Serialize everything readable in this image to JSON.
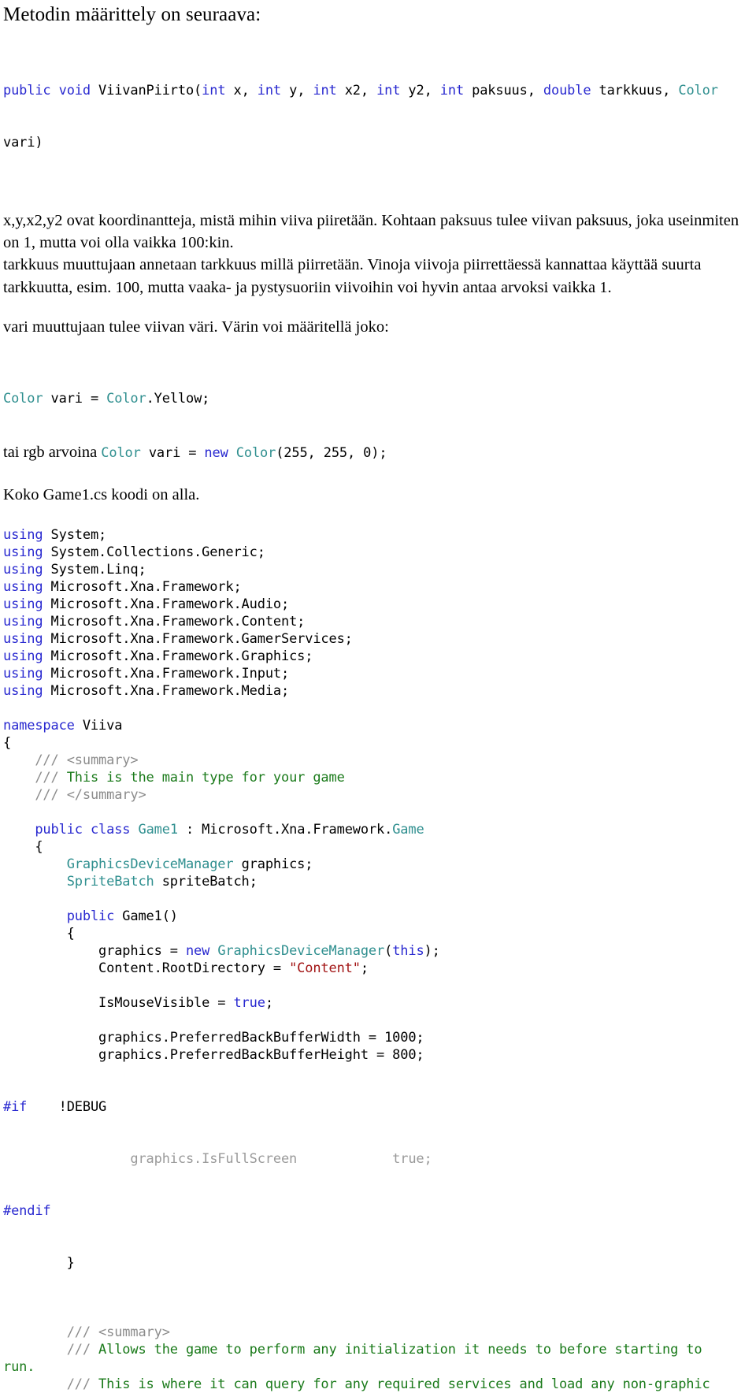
{
  "document": {
    "title": "Metodin määrittely on seuraava:",
    "signature": {
      "line1": [
        {
          "t": "public",
          "c": "kw"
        },
        {
          "t": " ",
          "c": "num"
        },
        {
          "t": "void",
          "c": "kw"
        },
        {
          "t": " ViivanPiirto(",
          "c": "num"
        },
        {
          "t": "int",
          "c": "kw"
        },
        {
          "t": " x, ",
          "c": "num"
        },
        {
          "t": "int",
          "c": "kw"
        },
        {
          "t": " y, ",
          "c": "num"
        },
        {
          "t": "int",
          "c": "kw"
        },
        {
          "t": " x2, ",
          "c": "num"
        },
        {
          "t": "int",
          "c": "kw"
        },
        {
          "t": " y2, ",
          "c": "num"
        },
        {
          "t": "int",
          "c": "kw"
        },
        {
          "t": " paksuus, ",
          "c": "num"
        },
        {
          "t": "double",
          "c": "kw"
        },
        {
          "t": " tarkkuus, ",
          "c": "num"
        },
        {
          "t": "Color",
          "c": "typ"
        }
      ],
      "line2": "vari)"
    },
    "paragraph1": "x,y,x2,y2 ovat koordinantteja, mistä mihin viiva piiretään. Kohtaan paksuus tulee viivan paksuus, joka useinmiten on 1, mutta voi olla vaikka 100:kin.",
    "paragraph2": "tarkkuus muuttujaan annetaan tarkkuus millä piirretään. Vinoja viivoja piirrettäessä kannattaa käyttää suurta tarkkuutta, esim. 100, mutta vaaka- ja pystysuoriin viivoihin voi hyvin antaa arvoksi vaikka 1.",
    "paragraph3": "vari muuttujaan tulee viivan väri. Värin voi määritellä joko:",
    "color_example_1": [
      {
        "t": "Color",
        "c": "typ"
      },
      {
        "t": " vari = ",
        "c": "num"
      },
      {
        "t": "Color",
        "c": "typ"
      },
      {
        "t": ".Yellow;",
        "c": "num"
      }
    ],
    "color_example_2_prefix": "tai rgb arvoina ",
    "color_example_2": [
      {
        "t": "Color",
        "c": "typ"
      },
      {
        "t": " vari = ",
        "c": "num"
      },
      {
        "t": "new",
        "c": "kw"
      },
      {
        "t": " ",
        "c": "num"
      },
      {
        "t": "Color",
        "c": "typ"
      },
      {
        "t": "(255, 255, 0);",
        "c": "num"
      }
    ],
    "paragraph4": "Koko Game1.cs koodi on alla."
  },
  "code_listing": {
    "usings": [
      [
        {
          "t": "using",
          "c": "kw"
        },
        {
          "t": " System;",
          "c": "num"
        }
      ],
      [
        {
          "t": "using",
          "c": "kw"
        },
        {
          "t": " System.Collections.Generic;",
          "c": "num"
        }
      ],
      [
        {
          "t": "using",
          "c": "kw"
        },
        {
          "t": " System.Linq;",
          "c": "num"
        }
      ],
      [
        {
          "t": "using",
          "c": "kw"
        },
        {
          "t": " Microsoft.Xna.Framework;",
          "c": "num"
        }
      ],
      [
        {
          "t": "using",
          "c": "kw"
        },
        {
          "t": " Microsoft.Xna.Framework.Audio;",
          "c": "num"
        }
      ],
      [
        {
          "t": "using",
          "c": "kw"
        },
        {
          "t": " Microsoft.Xna.Framework.Content;",
          "c": "num"
        }
      ],
      [
        {
          "t": "using",
          "c": "kw"
        },
        {
          "t": " Microsoft.Xna.Framework.GamerServices;",
          "c": "num"
        }
      ],
      [
        {
          "t": "using",
          "c": "kw"
        },
        {
          "t": " Microsoft.Xna.Framework.Graphics;",
          "c": "num"
        }
      ],
      [
        {
          "t": "using",
          "c": "kw"
        },
        {
          "t": " Microsoft.Xna.Framework.Input;",
          "c": "num"
        }
      ],
      [
        {
          "t": "using",
          "c": "kw"
        },
        {
          "t": " Microsoft.Xna.Framework.Media;",
          "c": "num"
        }
      ]
    ],
    "body": [
      [
        {
          "t": "namespace",
          "c": "kw"
        },
        {
          "t": " Viiva",
          "c": "num"
        }
      ],
      [
        {
          "t": "{",
          "c": "num"
        }
      ],
      [
        {
          "t": "    /// ",
          "c": "cms"
        },
        {
          "t": "<summary>",
          "c": "cms"
        }
      ],
      [
        {
          "t": "    /// ",
          "c": "cms"
        },
        {
          "t": "This is the main type for your game",
          "c": "cmt"
        }
      ],
      [
        {
          "t": "    /// ",
          "c": "cms"
        },
        {
          "t": "</summary>",
          "c": "cms"
        }
      ],
      [
        {
          "t": "",
          "c": "num"
        }
      ],
      [
        {
          "t": "    ",
          "c": "num"
        },
        {
          "t": "public",
          "c": "kw"
        },
        {
          "t": " ",
          "c": "num"
        },
        {
          "t": "class",
          "c": "kw"
        },
        {
          "t": " ",
          "c": "num"
        },
        {
          "t": "Game1",
          "c": "typ"
        },
        {
          "t": " : Microsoft.Xna.Framework.",
          "c": "num"
        },
        {
          "t": "Game",
          "c": "typ"
        }
      ],
      [
        {
          "t": "    {",
          "c": "num"
        }
      ],
      [
        {
          "t": "        ",
          "c": "num"
        },
        {
          "t": "GraphicsDeviceManager",
          "c": "typ"
        },
        {
          "t": " graphics;",
          "c": "num"
        }
      ],
      [
        {
          "t": "        ",
          "c": "num"
        },
        {
          "t": "SpriteBatch",
          "c": "typ"
        },
        {
          "t": " spriteBatch;",
          "c": "num"
        }
      ],
      [
        {
          "t": "",
          "c": "num"
        }
      ],
      [
        {
          "t": "        ",
          "c": "num"
        },
        {
          "t": "public",
          "c": "kw"
        },
        {
          "t": " Game1()",
          "c": "num"
        }
      ],
      [
        {
          "t": "        {",
          "c": "num"
        }
      ],
      [
        {
          "t": "            graphics = ",
          "c": "num"
        },
        {
          "t": "new",
          "c": "kw"
        },
        {
          "t": " ",
          "c": "num"
        },
        {
          "t": "GraphicsDeviceManager",
          "c": "typ"
        },
        {
          "t": "(",
          "c": "num"
        },
        {
          "t": "this",
          "c": "kw"
        },
        {
          "t": ");",
          "c": "num"
        }
      ],
      [
        {
          "t": "            Content.RootDirectory = ",
          "c": "num"
        },
        {
          "t": "\"Content\"",
          "c": "str"
        },
        {
          "t": ";",
          "c": "num"
        }
      ],
      [
        {
          "t": "",
          "c": "num"
        }
      ],
      [
        {
          "t": "            IsMouseVisible = ",
          "c": "num"
        },
        {
          "t": "true",
          "c": "kw"
        },
        {
          "t": ";",
          "c": "num"
        }
      ],
      [
        {
          "t": "",
          "c": "num"
        }
      ],
      [
        {
          "t": "            graphics.PreferredBackBufferWidth = 1000;",
          "c": "num"
        }
      ],
      [
        {
          "t": "            graphics.PreferredBackBufferHeight = 800;",
          "c": "num"
        }
      ]
    ],
    "preprocessor": {
      "if_directive": "#if",
      "if_condition": "    !DEBUG",
      "inactive_line": "                graphics.IsFullScreen            true;",
      "endif_directive": "#endif",
      "close_brace": "        }"
    },
    "trailing_comments": [
      {
        "slashes": "        /// ",
        "tag": "<summary>",
        "text": ""
      },
      {
        "slashes": "        /// ",
        "tag": "",
        "text": "Allows the game to perform any initialization it needs to before starting to"
      },
      {
        "slashes": "",
        "tag": "",
        "text": "run.",
        "flush": true
      },
      {
        "slashes": "        /// ",
        "tag": "",
        "text": "This is where it can query for any required services and load any non-graphic"
      }
    ]
  },
  "colors": {
    "keyword": "#2929d0",
    "type": "#2f8f8f",
    "string": "#a21515",
    "comment": "#1a7a1a",
    "comment_slash": "#8c8c8c",
    "inactive": "#9a9a9a",
    "text": "#000000",
    "background": "#ffffff"
  }
}
